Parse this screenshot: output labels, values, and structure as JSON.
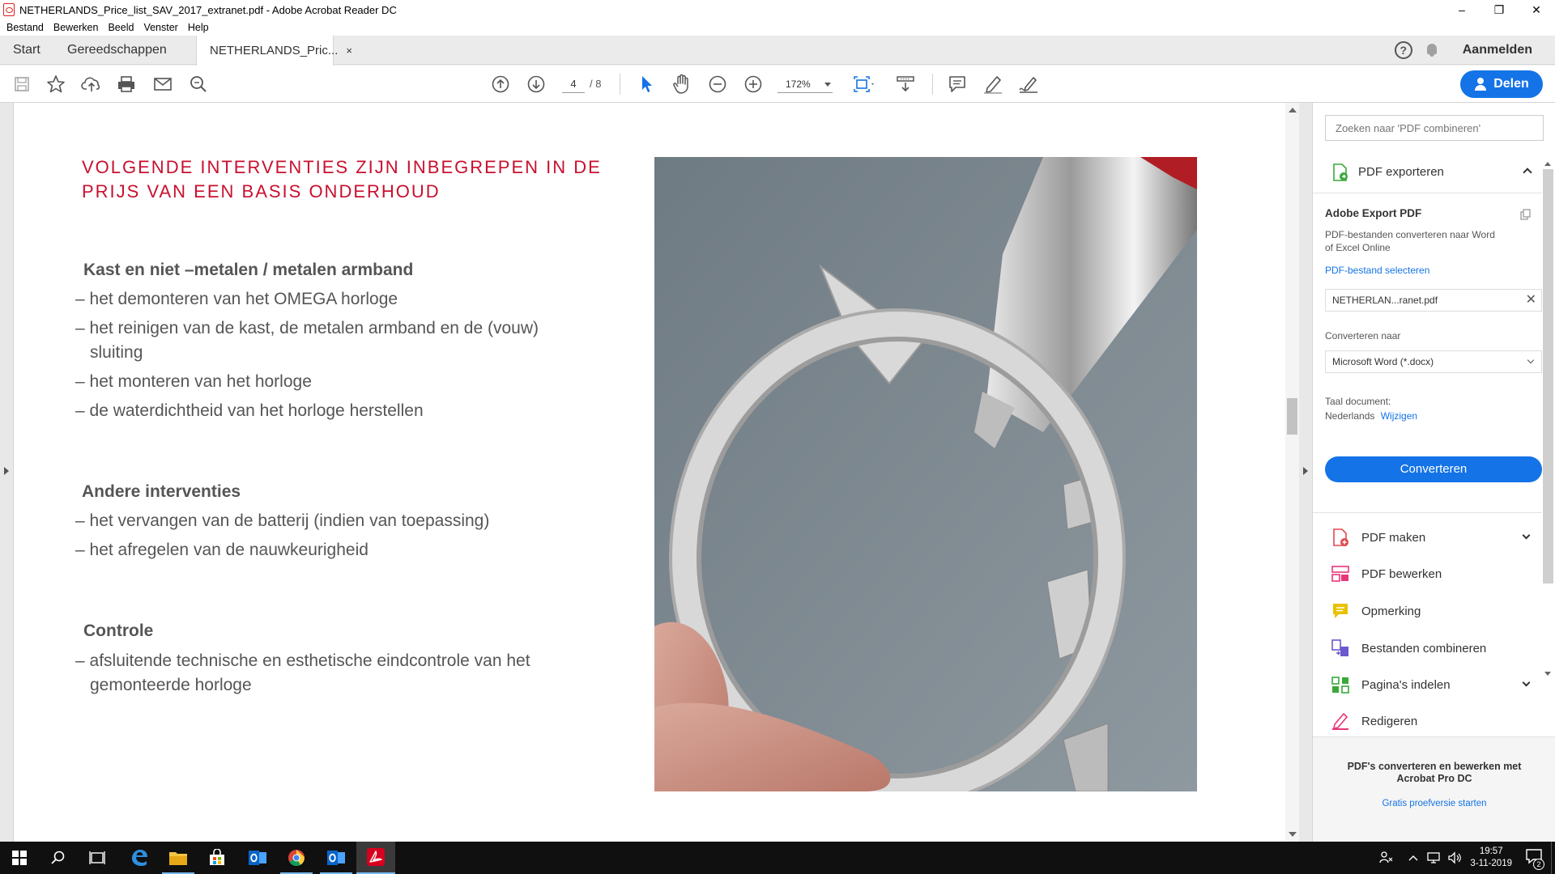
{
  "window": {
    "title": "NETHERLANDS_Price_list_SAV_2017_extranet.pdf - Adobe Acrobat Reader DC",
    "minimize": "–",
    "maximize": "❐",
    "close": "✕"
  },
  "menu": [
    "Bestand",
    "Bewerken",
    "Beeld",
    "Venster",
    "Help"
  ],
  "tabs": {
    "start": "Start",
    "tools": "Gereedschappen",
    "document": "NETHERLANDS_Pric...",
    "close": "×"
  },
  "header_right": {
    "help": "?",
    "signin": "Aanmelden"
  },
  "toolbar": {
    "page_current": "4",
    "page_total": "/ 8",
    "zoom": "172%",
    "share": "Delen"
  },
  "document": {
    "heading": "VOLGENDE INTERVENTIES ZIJN INBEGREPEN IN DE PRIJS VAN EEN BASIS ONDERHOUD",
    "sections": [
      {
        "title": "Kast en niet –metalen / metalen armband",
        "items": [
          "– het demonteren van het OMEGA horloge",
          "– het reinigen van de kast, de metalen armband en de (vouw)",
          "sluiting",
          "– het monteren van het horloge",
          "– de waterdichtheid van het horloge herstellen"
        ]
      },
      {
        "title": "Andere interventies",
        "items": [
          "– het vervangen van de batterij (indien van toepassing)",
          "– het afregelen van de nauwkeurigheid"
        ]
      },
      {
        "title": "Controle",
        "items": [
          "– afsluitende technische en esthetische eindcontrole van het",
          "gemonteerde horloge"
        ]
      }
    ]
  },
  "right_panel": {
    "search_placeholder": "Zoeken naar 'PDF combineren'",
    "export_label": "PDF exporteren",
    "export_title": "Adobe Export PDF",
    "export_desc_1": "PDF-bestanden converteren naar Word",
    "export_desc_2": "of Excel Online",
    "select_file_link": "PDF-bestand selecteren",
    "file_name": "NETHERLAN...ranet.pdf",
    "convert_to_label": "Converteren naar",
    "convert_to_value": "Microsoft Word (*.docx)",
    "language_label": "Taal document:",
    "language_value": "Nederlands",
    "language_change": "Wijzigen",
    "convert_button": "Converteren",
    "tools": [
      {
        "label": "PDF maken",
        "expandable": true,
        "color": "#e34850"
      },
      {
        "label": "PDF bewerken",
        "expandable": false,
        "color": "#e8357a"
      },
      {
        "label": "Opmerking",
        "expandable": false,
        "color": "#e8c200"
      },
      {
        "label": "Bestanden combineren",
        "expandable": false,
        "color": "#6a5acd"
      },
      {
        "label": "Pagina's indelen",
        "expandable": true,
        "color": "#3aa83a"
      },
      {
        "label": "Redigeren",
        "expandable": false,
        "color": "#e8357a"
      }
    ],
    "footer_title": "PDF's converteren en bewerken met Acrobat Pro DC",
    "footer_link": "Gratis proefversie starten"
  },
  "taskbar": {
    "time": "19:57",
    "date": "3-11-2019",
    "notifications": "2"
  },
  "colors": {
    "accent": "#1473e6",
    "heading_red": "#c8102e"
  }
}
